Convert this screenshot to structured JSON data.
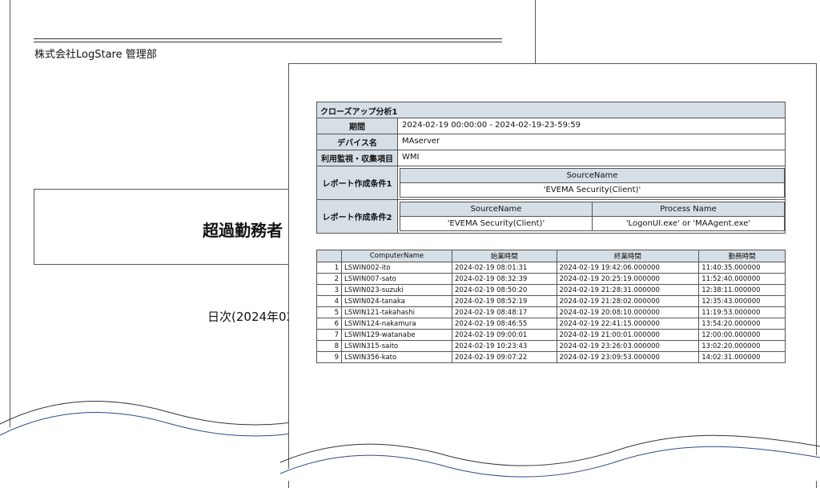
{
  "cover": {
    "company": "株式会社LogStare 管理部",
    "title": "超過勤務者",
    "period": "日次(2024年02"
  },
  "conditions": {
    "header": "クローズアップ分析1",
    "rows": [
      {
        "label": "期間",
        "value": "2024-02-19 00:00:00 - 2024-02-19-23-59:59"
      },
      {
        "label": "デバイス名",
        "value": "MAserver"
      },
      {
        "label": "利用監視・収集項目",
        "value": "WMI"
      }
    ],
    "condition1": {
      "label": "レポート作成条件1",
      "headers": [
        "SourceName"
      ],
      "values": [
        "'EVEMA Security(Client)'"
      ]
    },
    "condition2": {
      "label": "レポート作成条件2",
      "headers": [
        "SourceName",
        "Process Name"
      ],
      "values": [
        "'EVEMA Security(Client)'",
        "'LogonUI.exe' or 'MAAgent.exe'"
      ]
    }
  },
  "table": {
    "columns": [
      "",
      "ComputerName",
      "始業時間",
      "終業時間",
      "勤務時間"
    ],
    "rows": [
      [
        "1",
        "LSWIN002-ito",
        "2024-02-19 08:01:31",
        "2024-02-19 19:42:06.000000",
        "11:40:35.000000"
      ],
      [
        "2",
        "LSWIN007-sato",
        "2024-02-19 08:32:39",
        "2024-02-19 20:25:19.000000",
        "11:52:40.000000"
      ],
      [
        "3",
        "LSWIN023-suzuki",
        "2024-02-19 08:50:20",
        "2024-02-19 21:28:31.000000",
        "12:38:11.000000"
      ],
      [
        "4",
        "LSWIN024-tanaka",
        "2024-02-19 08:52:19",
        "2024-02-19 21:28:02.000000",
        "12:35:43.000000"
      ],
      [
        "5",
        "LSWIN121-takahashi",
        "2024-02-19 08:48:17",
        "2024-02-19 20:08:10.000000",
        "11:19:53.000000"
      ],
      [
        "6",
        "LSWIN124-nakamura",
        "2024-02-19 08:46:55",
        "2024-02-19 22:41:15.000000",
        "13:54:20.000000"
      ],
      [
        "7",
        "LSWIN129-watanabe",
        "2024-02-19 09:00:01",
        "2024-02-19 21:00:01.000000",
        "12:00:00.000000"
      ],
      [
        "8",
        "LSWIN315-saito",
        "2024-02-19 10:23:43",
        "2024-02-19 23:26:03.000000",
        "13:02:20.000000"
      ],
      [
        "9",
        "LSWIN356-kato",
        "2024-02-19 09:07:22",
        "2024-02-19 23:09:53.000000",
        "14:02:31.000000"
      ]
    ]
  }
}
